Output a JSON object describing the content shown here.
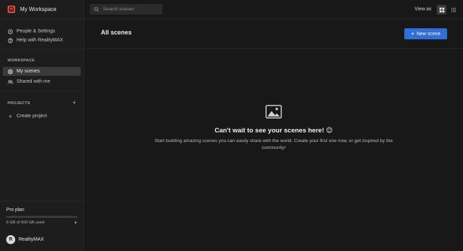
{
  "workspace": {
    "title": "My Workspace",
    "brand_color": "#e0443a"
  },
  "sidebar": {
    "links": [
      {
        "label": "People & Settings",
        "icon": "gear-icon"
      },
      {
        "label": "Help with RealityMAX",
        "icon": "help-icon"
      }
    ],
    "workspace_label": "WORKSPACE",
    "nav": [
      {
        "label": "My scenes",
        "icon": "scenes-icon",
        "active": true
      },
      {
        "label": "Shared with me",
        "icon": "users-icon",
        "active": false
      }
    ],
    "projects_label": "PROJECTS",
    "create_project_label": "Create project",
    "plan": {
      "title": "Pro plan",
      "usage": "0 GB of 500 GB used",
      "used_fraction": 0.0
    },
    "user": {
      "initial": "R",
      "name": "RealityMAX"
    }
  },
  "topbar": {
    "search_placeholder": "Search scenes",
    "view_as_label": "View as",
    "views": [
      "grid",
      "list"
    ],
    "active_view": "grid"
  },
  "main": {
    "title": "All scenes",
    "new_button_label": "New scene",
    "accent_color": "#2f6fd6",
    "empty_title": "Can't wait to see your scenes here! 😊",
    "empty_description": "Start building amazing scenes you can easily share with the world. Create your first one now, or get inspired by the community!"
  }
}
